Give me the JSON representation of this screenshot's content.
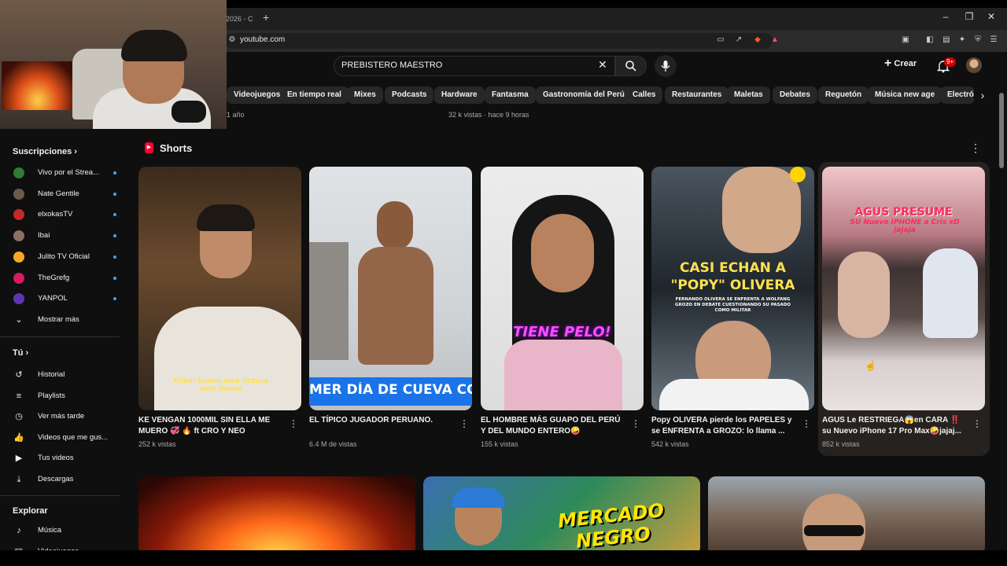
{
  "browser": {
    "tab_title": "2026 - C",
    "url": "youtube.com",
    "window_controls": [
      "–",
      "❐",
      "✕"
    ]
  },
  "header": {
    "search_query": "PREBISTERO MAESTRO",
    "create_label": "Crear",
    "notification_badge": "9+"
  },
  "chips": [
    "Videojuegos",
    "En tiempo real",
    "Mixes",
    "Podcasts",
    "Hardware",
    "Fantasma",
    "Gastronomía del Perú",
    "Calles",
    "Restaurantes",
    "Maletas",
    "Debates",
    "Reguetón",
    "Música new age",
    "Electróni"
  ],
  "previous_row": {
    "left_meta": "1 año",
    "center_meta": "32 k vistas · hace 9 horas"
  },
  "sidebar": {
    "subscriptions_title": "Suscripciones",
    "subscriptions": [
      {
        "label": "Vivo por el Strea...",
        "color": "#2e7d32"
      },
      {
        "label": "Nate Gentile",
        "color": "#6d5a4a"
      },
      {
        "label": "elxokasTV",
        "color": "#c62828"
      },
      {
        "label": "Ibai",
        "color": "#8d6e63"
      },
      {
        "label": "Julito TV Oficial",
        "color": "#f9a825"
      },
      {
        "label": "TheGrefg",
        "color": "#d81b60"
      },
      {
        "label": "YANPOL",
        "color": "#5e35b1"
      }
    ],
    "show_more": "Mostrar más",
    "you_title": "Tú",
    "you_items": [
      {
        "label": "Historial",
        "icon": "history-icon"
      },
      {
        "label": "Playlists",
        "icon": "playlist-icon"
      },
      {
        "label": "Ver más tarde",
        "icon": "clock-icon"
      },
      {
        "label": "Videos que me gus...",
        "icon": "thumbs-up-icon"
      },
      {
        "label": "Tus videos",
        "icon": "play-square-icon"
      },
      {
        "label": "Descargas",
        "icon": "download-icon"
      }
    ],
    "explore_title": "Explorar",
    "explore_items": [
      {
        "label": "Música",
        "icon": "music-icon"
      },
      {
        "label": "Videojuegos",
        "icon": "gamepad-icon"
      }
    ]
  },
  "shorts": {
    "title": "Shorts",
    "items": [
      {
        "title": "KE VENGAN 1000MIL SIN ELLA ME MUERO 💞 🔥 ft CRO Y NEO",
        "views": "252 k vistas",
        "caption": "Khea: bueno esta ritmica esta buena"
      },
      {
        "title": "EL TÍPICO JUGADOR PERUANO.",
        "views": "6.4 M de vistas",
        "caption": "MER DÍA DE CUEVA CC"
      },
      {
        "title": "EL HOMBRE MÁS GUAPO DEL PERÚ Y DEL MUNDO ENTERO🤪",
        "views": "155 k vistas",
        "caption": "TIENE PELO!"
      },
      {
        "title": "Popy OLIVERA pierde los PAPELES y se ENFRENTA a GROZO: lo llama ...",
        "views": "542 k vistas",
        "caption": "CASI ECHAN A \"POPY\" OLIVERA",
        "subcaption": "FERNANDO OLIVERA SE ENFRENTA A WOLFANG GROZO EN DEBATE CUESTIONANDO SU PASADO COMO MILITAR"
      },
      {
        "title": "AGUS Le RESTRIEGA😱en CARA ‼️ su Nuevo iPhone 17 Pro Max🤪jajaj...",
        "views": "852 k vistas",
        "caption": "AGUS PRESUME",
        "subcaption": "SU Nuevo IPHONE a Cris xD jajaja"
      }
    ]
  },
  "bottom_row": {
    "thumb2_text": "MERCADO NEGRO"
  }
}
